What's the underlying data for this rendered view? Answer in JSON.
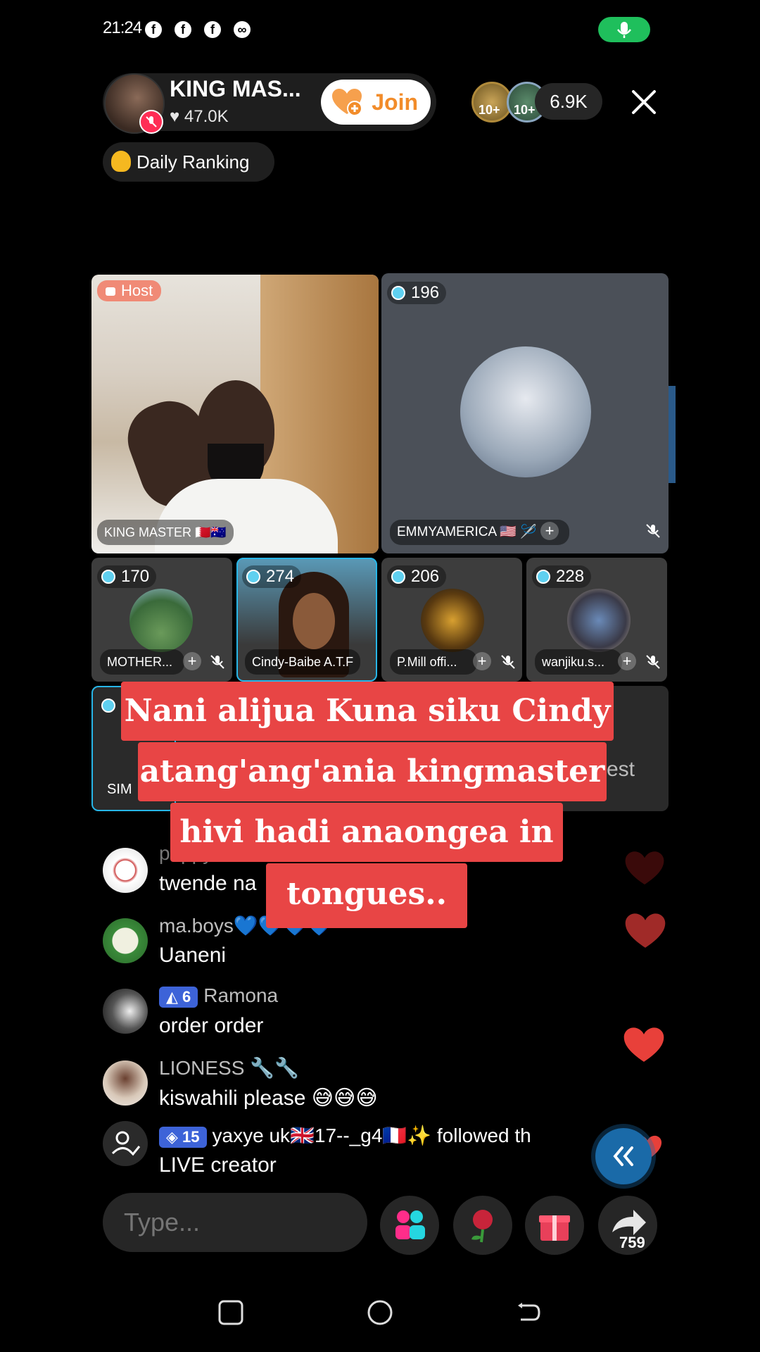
{
  "status_bar": {
    "time": "21:24",
    "fb_glyph": "f",
    "game_glyph": "∞"
  },
  "host": {
    "name": "KING MAS...",
    "likes": "47.0K",
    "join_label": "Join"
  },
  "viewers": {
    "badge_1": "10+",
    "badge_2": "10+",
    "count": "6.9K"
  },
  "ranking_label": "Daily Ranking",
  "tiles": {
    "host_tag": "Host",
    "host_name": "KING MASTER 🇧🇭🇦🇺",
    "main_guest": {
      "score": "196",
      "name": "EMMYAMERICA 🇺🇸 🪡"
    },
    "small": [
      {
        "score": "170",
        "name": "MOTHER..."
      },
      {
        "score": "274",
        "name": "Cindy-Baibe A.T.F"
      },
      {
        "score": "206",
        "name": "P.Mill offi..."
      },
      {
        "score": "228",
        "name": "wanjiku.s..."
      }
    ],
    "row3_left": "SIM",
    "row3_right": "est",
    "plus_symbol": "+"
  },
  "caption": {
    "line1": "Nani alijua Kuna siku Cindy",
    "line2": "atang'ang'ania kingmaster",
    "line3": "hivi hadi anaongea in",
    "line4": "tongues.."
  },
  "chat": [
    {
      "user": "puppy",
      "message": "twende na"
    },
    {
      "user": "ma.boys💙💙💙💙",
      "message": "Uaneni"
    },
    {
      "level": "6",
      "user": "Ramona",
      "message": "order order"
    },
    {
      "user": "LIONESS 🔧🔧",
      "message": "kiswahili please 😅😅😅"
    },
    {
      "level": "15",
      "user": "yaxye uk🇬🇧17--_g4🇫🇷✨ followed th",
      "message": "LIVE creator"
    }
  ],
  "bottom": {
    "type_placeholder": "Type...",
    "share_count": "759"
  }
}
